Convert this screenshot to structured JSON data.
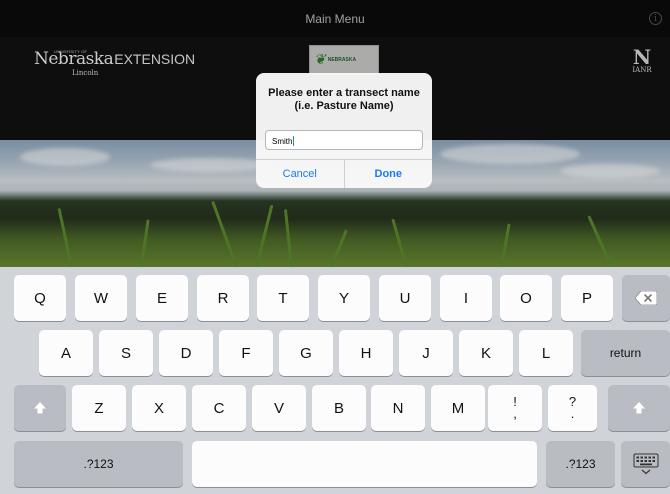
{
  "navbar": {
    "title": "Main Menu",
    "info_glyph": "i"
  },
  "header": {
    "unl_logo": {
      "university": "UNIVERSITY OF",
      "name": "Nebraska",
      "campus": "Lincoln",
      "division": "EXTENSION"
    },
    "center_logo": {
      "text": "NEBRASKA"
    },
    "ianr_logo": {
      "letter": "N",
      "text": "IANR"
    }
  },
  "alert": {
    "title_line1": "Please enter a transect name",
    "title_line2": "(i.e. Pasture Name)",
    "input_value": "Smith",
    "cancel_label": "Cancel",
    "done_label": "Done"
  },
  "keyboard": {
    "row1": [
      "Q",
      "W",
      "E",
      "R",
      "T",
      "Y",
      "U",
      "I",
      "O",
      "P"
    ],
    "row2": [
      "A",
      "S",
      "D",
      "F",
      "G",
      "H",
      "J",
      "K",
      "L"
    ],
    "row3": [
      "Z",
      "X",
      "C",
      "V",
      "B",
      "N",
      "M"
    ],
    "punct1": {
      "top": "!",
      "bottom": ","
    },
    "punct2": {
      "top": "?",
      "bottom": "."
    },
    "return_label": "return",
    "numbers_label": ".?123",
    "icons": [
      "delete-icon",
      "shift-icon",
      "hide-keyboard-icon"
    ],
    "key_color": "#fcfcfd",
    "fn_key_color": "#b9bcc3"
  },
  "accent_color": "#1a7af5"
}
